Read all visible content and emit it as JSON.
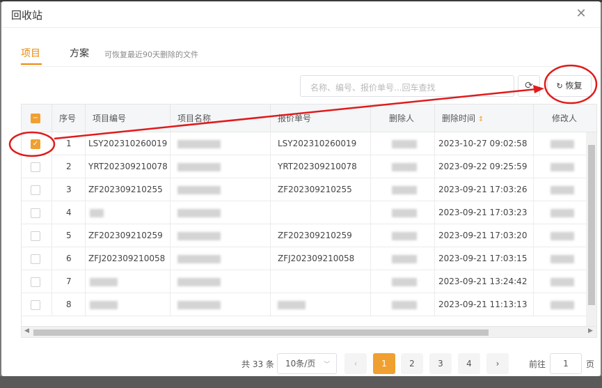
{
  "dialog": {
    "title": "回收站",
    "close_icon": "close-icon"
  },
  "tabs": [
    {
      "label": "项目",
      "active": true
    },
    {
      "label": "方案",
      "active": false
    }
  ],
  "tab_hint": "可恢复最近90天删除的文件",
  "toolbar": {
    "search_placeholder": "名称、编号、报价单号...回车查找",
    "refresh_icon": "refresh-icon",
    "restore_label": "恢复",
    "restore_icon": "restore-icon"
  },
  "table": {
    "columns": [
      "序号",
      "项目编号",
      "项目名称",
      "报价单号",
      "删除人",
      "删除时间",
      "修改人"
    ],
    "sort_icon": "sort-icon",
    "header_checkbox": "indeterminate",
    "rows": [
      {
        "checked": true,
        "index": "1",
        "project_no": "LSY202310260019",
        "quote_no": "LSY202310260019",
        "deleted_at": "2023-10-27 09:02:58"
      },
      {
        "checked": false,
        "index": "2",
        "project_no": "YRT202309210078",
        "quote_no": "YRT202309210078",
        "deleted_at": "2023-09-22 09:25:59"
      },
      {
        "checked": false,
        "index": "3",
        "project_no": "ZF202309210255",
        "quote_no": "ZF202309210255",
        "deleted_at": "2023-09-21 17:03:26"
      },
      {
        "checked": false,
        "index": "4",
        "project_no": "",
        "quote_no": "",
        "deleted_at": "2023-09-21 17:03:23"
      },
      {
        "checked": false,
        "index": "5",
        "project_no": "ZF202309210259",
        "quote_no": "ZF202309210259",
        "deleted_at": "2023-09-21 17:03:20"
      },
      {
        "checked": false,
        "index": "6",
        "project_no": "ZFJ202309210058",
        "quote_no": "ZFJ202309210058",
        "deleted_at": "2023-09-21 17:03:15"
      },
      {
        "checked": false,
        "index": "7",
        "project_no": "",
        "quote_no": "",
        "deleted_at": "2023-09-21 13:24:42"
      },
      {
        "checked": false,
        "index": "8",
        "project_no": "",
        "quote_no": "",
        "deleted_at": "2023-09-21 11:13:13"
      }
    ]
  },
  "pagination": {
    "total": "共 33 条",
    "page_size": "10条/页",
    "pages": [
      "1",
      "2",
      "3",
      "4"
    ],
    "current": "1",
    "goto_label": "前往",
    "goto_value": "1",
    "goto_unit": "页"
  },
  "colors": {
    "accent": "#f0a030",
    "annotation": "#e01b1b"
  }
}
